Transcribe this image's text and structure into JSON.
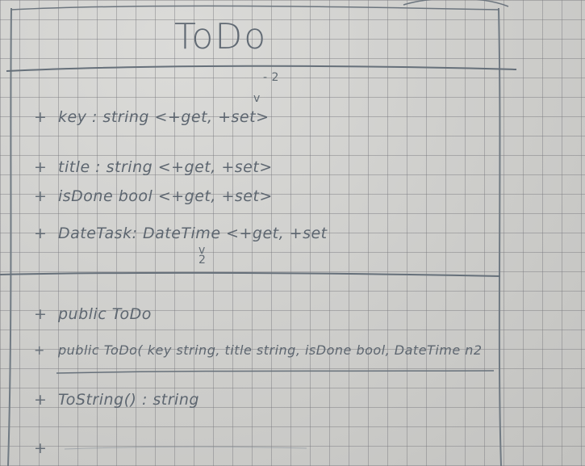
{
  "class_name": "ToDo",
  "attributes": [
    {
      "visibility": "+",
      "text": "key : string <+get, +set>"
    },
    {
      "visibility": "+",
      "text": "title : string <+get, +set>"
    },
    {
      "visibility": "+",
      "text": "isDone bool <+get, +set>"
    },
    {
      "visibility": "+",
      "text": "DateTask: DateTime <+get, +set"
    }
  ],
  "methods": [
    {
      "visibility": "+",
      "text": "public ToDo"
    },
    {
      "visibility": "+",
      "text": "public ToDo( key string, title string, isDone bool, DateTime n2"
    },
    {
      "visibility": "+",
      "text": "ToString() : string"
    },
    {
      "visibility": "+",
      "text": ""
    }
  ],
  "annotations": {
    "top_mark": "- 2",
    "key_mark": "v",
    "date_mark": "v\n2"
  },
  "colors": {
    "paper": "#d3d3d0",
    "grid": "#7d7d82",
    "ink": "#5d6670"
  }
}
